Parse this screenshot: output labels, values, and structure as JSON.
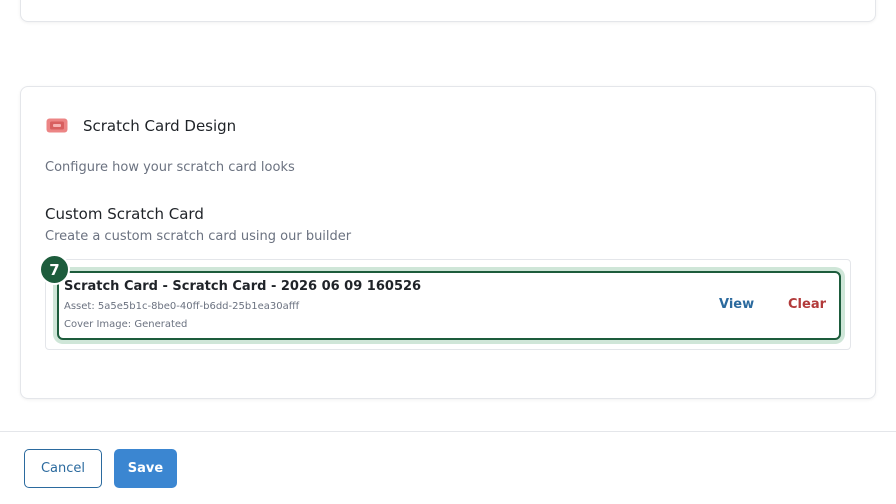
{
  "design_section": {
    "title": "Scratch Card Design",
    "description": "Configure how your scratch card looks",
    "icon": "ticket-icon",
    "custom": {
      "title": "Custom Scratch Card",
      "description": "Create a custom scratch card using our builder",
      "asset": {
        "name": "Scratch Card - Scratch Card - 2026 06 09 160526",
        "asset_id": "Asset: 5a5e5b1c-8be0-40ff-b6dd-25b1ea30afff",
        "cover": "Cover Image: Generated",
        "view_label": "View",
        "clear_label": "Clear"
      }
    }
  },
  "step_badge": "7",
  "footer": {
    "cancel_label": "Cancel",
    "save_label": "Save"
  },
  "colors": {
    "accent": "#3b86d1",
    "badge": "#1d5c3c",
    "danger": "#b23a3a",
    "icon": "#e07a7a"
  }
}
